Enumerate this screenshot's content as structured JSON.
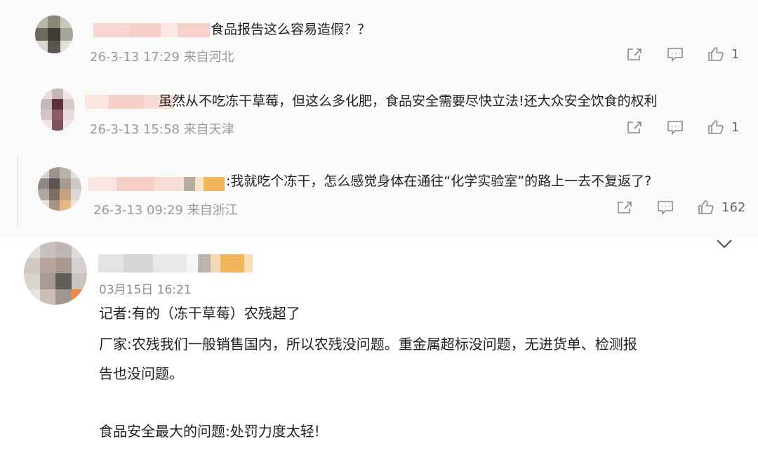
{
  "comments": [
    {
      "text": "食品报告这么容易造假？？",
      "meta": "26-3-13 17:29 来自河北",
      "like_count": "1"
    },
    {
      "text": "虽然从不吃冻干草莓，但这么多化肥，食品安全需要尽快立法!还大众安全饮食的权利",
      "meta": "26-3-13 15:58 来自天津",
      "like_count": "1"
    },
    {
      "text": ":我就吃个冻干，怎么感觉身体在通往“化学实验室”的路上一去不复返了?",
      "meta": "26-3-13 09:29 来自浙江",
      "like_count": "162"
    }
  ],
  "post": {
    "time": "03月15日 16:21",
    "lines": [
      "记者:有的（冻干草莓）农残超了",
      "厂家:农残我们一般销售国内，所以农残没问题。重金属超标没问题，无进货单、检测报",
      "告也没问题。",
      "食品安全最大的问题:处罚力度太轻!"
    ]
  },
  "icons": {
    "share": "share-icon",
    "comment": "comment-icon",
    "like": "thumbs-up-icon",
    "expand": "chevron-down-icon"
  },
  "colors": {
    "meta_text": "#9a9a9a",
    "icon": "#8a8a8a",
    "blur_pink": "#f6cfc8",
    "blur_orange": "#f2b55b"
  }
}
